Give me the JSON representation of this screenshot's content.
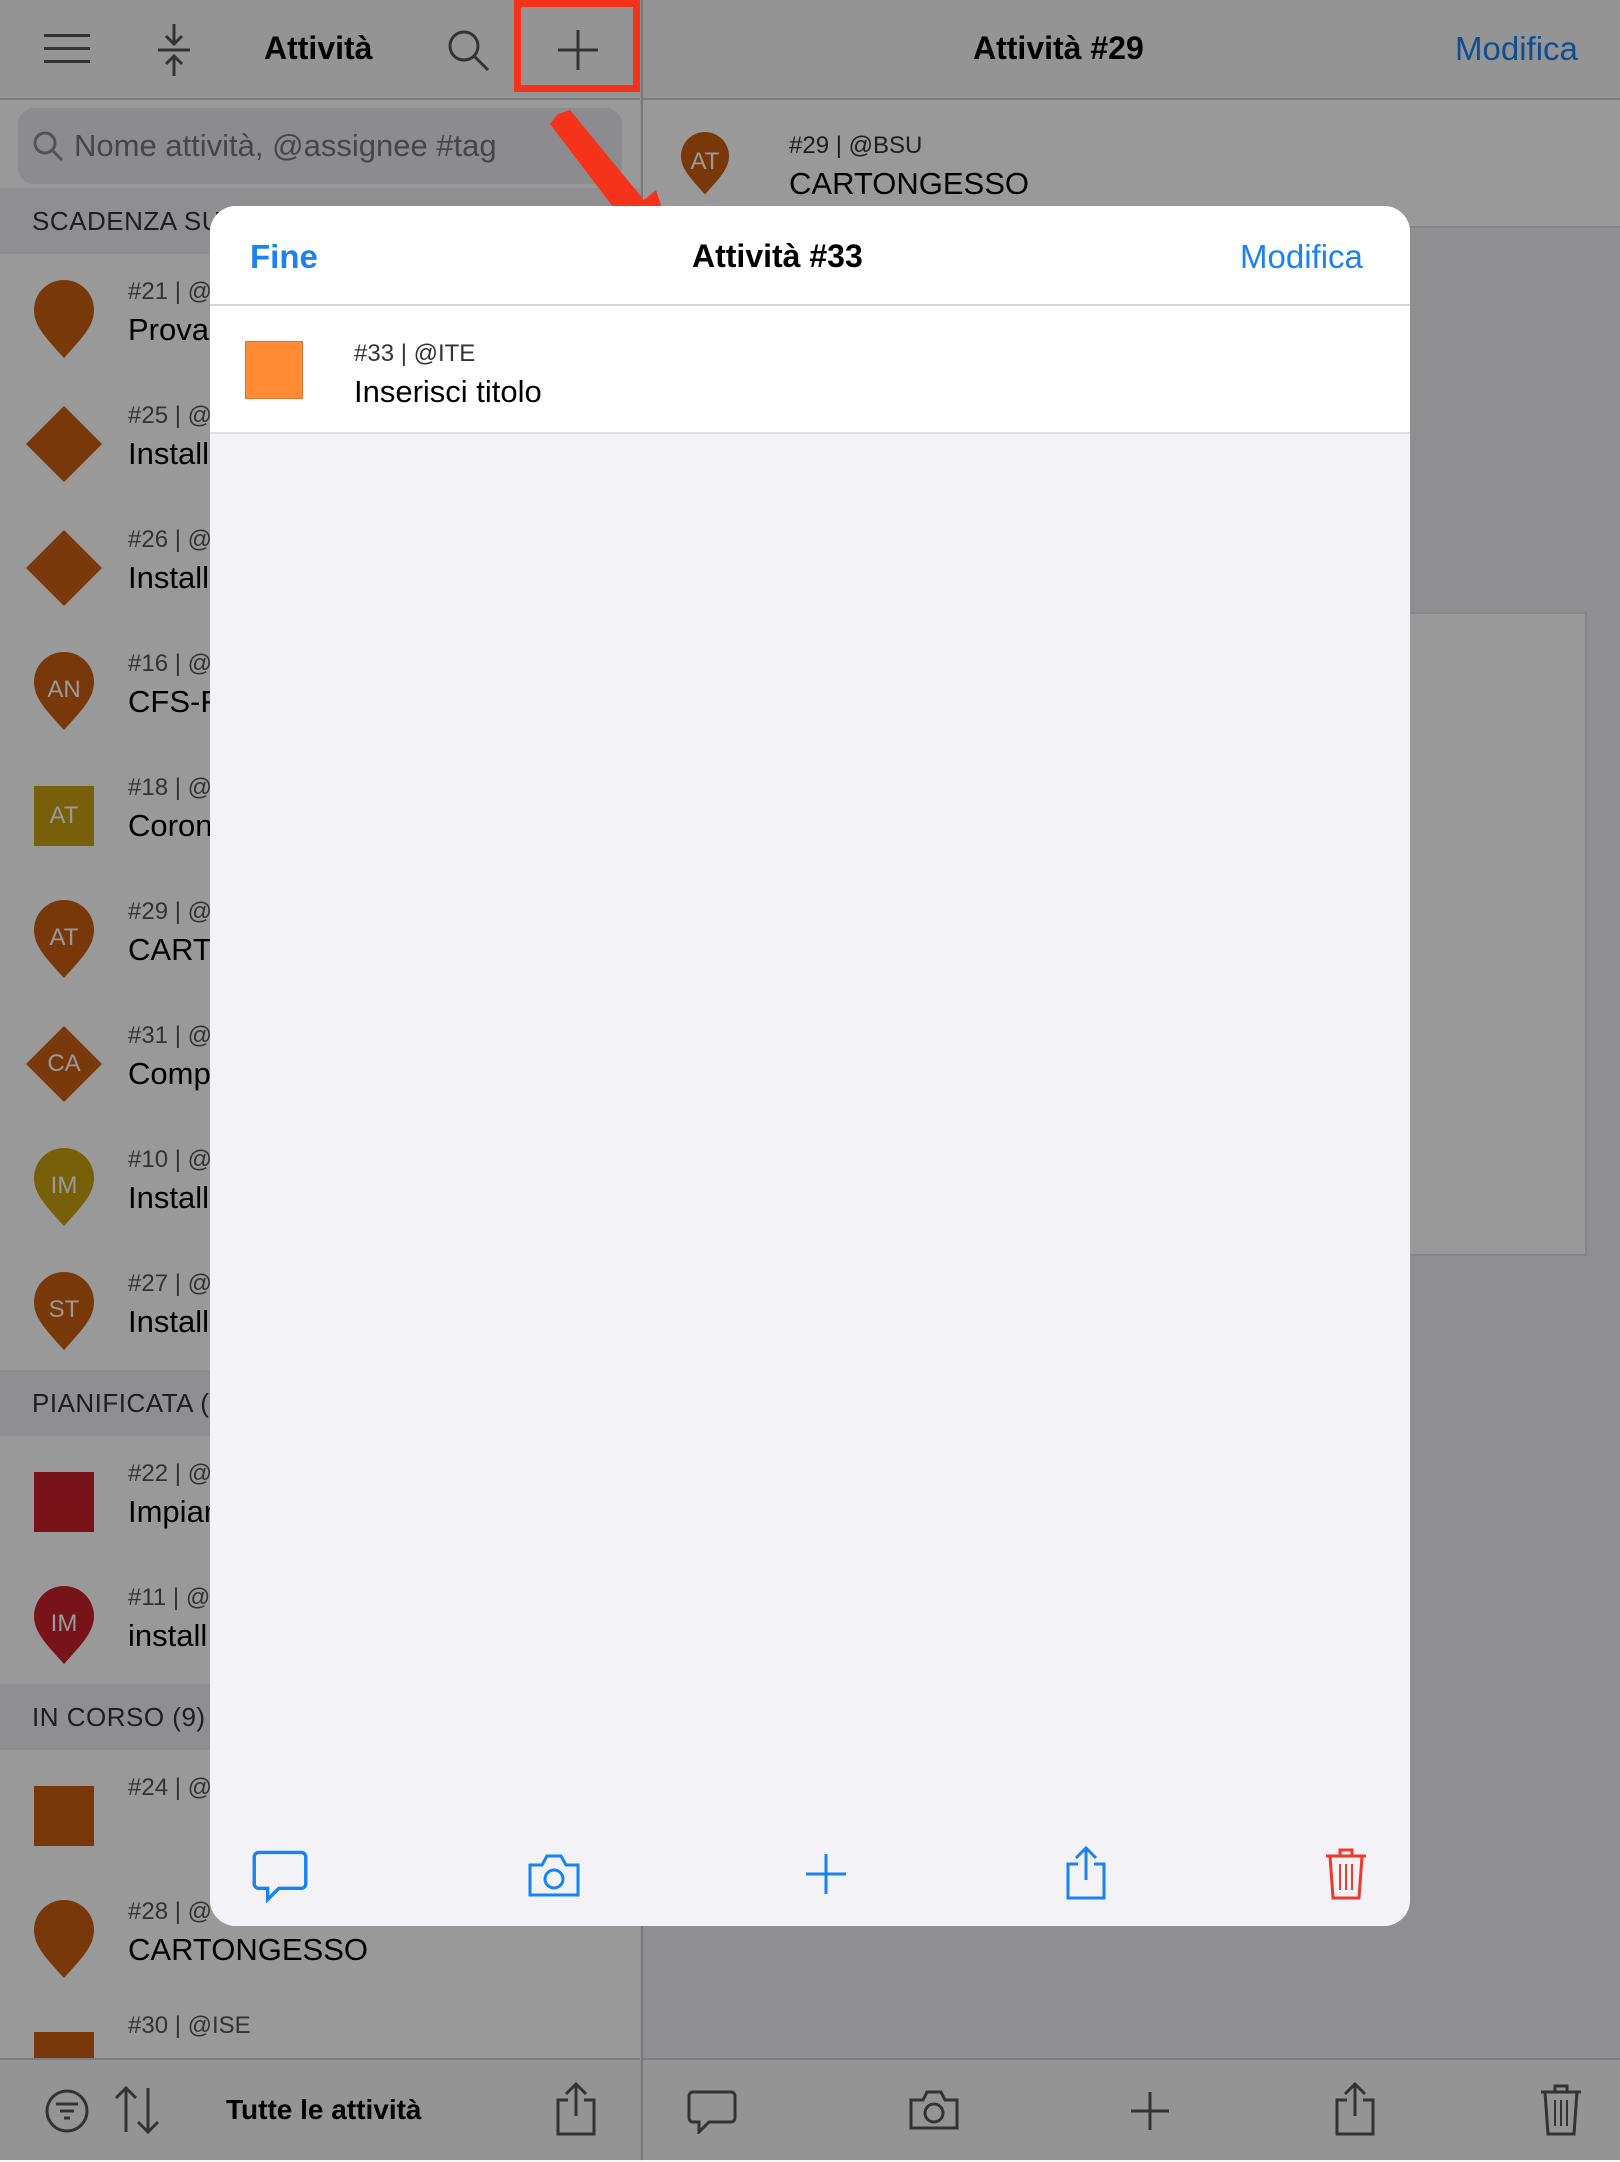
{
  "left_pane": {
    "title": "Attività",
    "search_placeholder": "Nome attività, @assignee #tag",
    "sections": [
      {
        "label": "SCADENZA SU"
      },
      {
        "label": "PIANIFICATA (2"
      },
      {
        "label": "IN CORSO (9)"
      }
    ],
    "rows": [
      {
        "meta": "#21 | @",
        "title": "Prova",
        "marker": ""
      },
      {
        "meta": "#25 | @",
        "title": "Install",
        "marker": ""
      },
      {
        "meta": "#26 | @",
        "title": "Install",
        "marker": ""
      },
      {
        "meta": "#16 | @",
        "title": "CFS-F",
        "marker": "AN"
      },
      {
        "meta": "#18 | @",
        "title": "Coron",
        "marker": "AT"
      },
      {
        "meta": "#29 | @",
        "title": "CARTO",
        "marker": "AT"
      },
      {
        "meta": "#31 | @",
        "title": "Comp",
        "marker": "CA"
      },
      {
        "meta": "#10 | @",
        "title": "Install",
        "marker": "IM"
      },
      {
        "meta": "#27 | @",
        "title": "Install",
        "marker": "ST"
      },
      {
        "meta": "#22 | @",
        "title": "Impian",
        "marker": ""
      },
      {
        "meta": "#11 | @",
        "title": "install",
        "marker": "IM"
      },
      {
        "meta": "#24 | @",
        "title": "",
        "marker": ""
      },
      {
        "meta": "#28 | @",
        "title": "CARTONGESSO",
        "marker": ""
      },
      {
        "meta": "#30 | @ISE",
        "title": "",
        "marker": ""
      }
    ],
    "bottom_label": "Tutte le attività"
  },
  "right_pane": {
    "title": "Attività #29",
    "edit_label": "Modifica",
    "task_meta": "#29 | @BSU",
    "task_title": "CARTONGESSO",
    "marker": "AT"
  },
  "modal": {
    "done_label": "Fine",
    "title": "Attività #33",
    "edit_label": "Modifica",
    "task_meta": "#33 | @ITE",
    "task_title": "Inserisci titolo"
  },
  "colors": {
    "accent": "#1a82f2",
    "danger": "#f0392e",
    "highlight": "#f5321a",
    "task_orange": "#ff8c35",
    "marker_brown": "#c85e12",
    "marker_yellow": "#c9a012",
    "marker_red": "#c8222a"
  },
  "icons": [
    "menu-icon",
    "collapse-icon",
    "search-icon",
    "plus-icon",
    "comment-icon",
    "camera-icon",
    "share-icon",
    "trash-icon",
    "filter-icon",
    "sort-icon"
  ]
}
